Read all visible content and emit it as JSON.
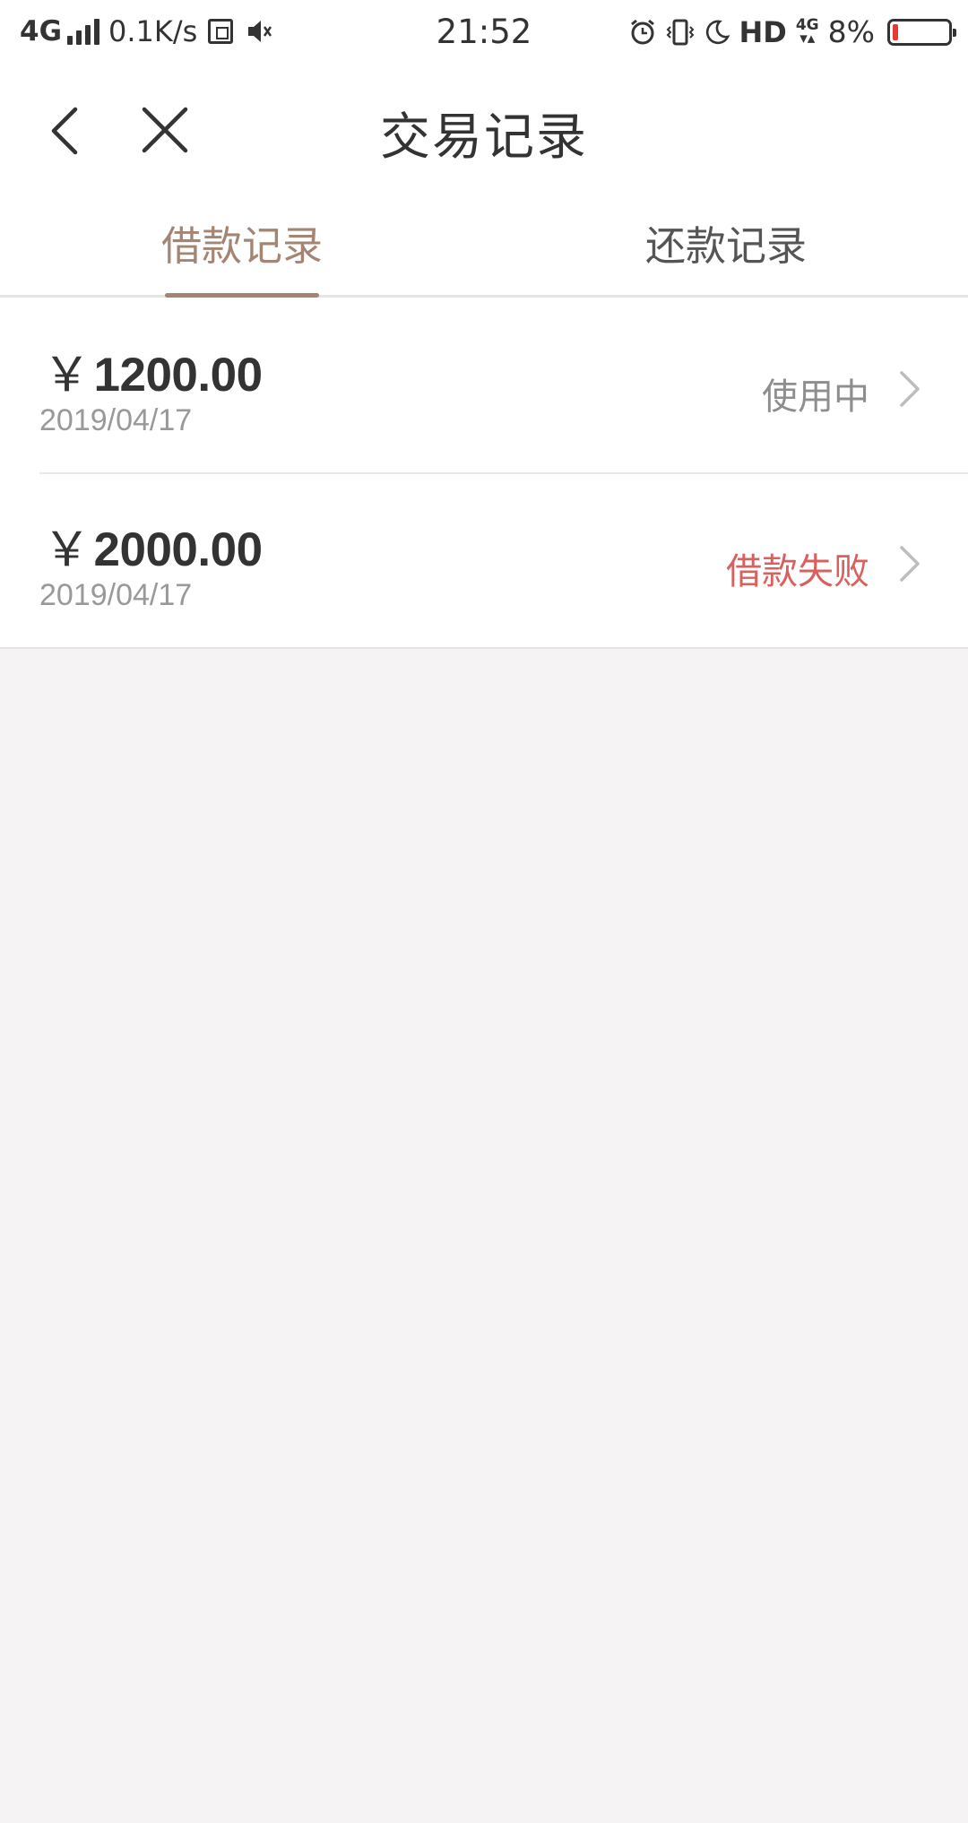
{
  "status_bar": {
    "network": "4G",
    "speed": "0.1K/s",
    "time": "21:52",
    "hd": "HD",
    "mini_4g": "4G",
    "battery_text": "8%",
    "battery_level": 0.08,
    "icons": [
      "signal-icon",
      "sim-icon",
      "mute-icon",
      "alarm-icon",
      "vibrate-icon",
      "moon-icon",
      "battery-icon"
    ]
  },
  "header": {
    "title": "交易记录",
    "back_icon": "chevron-left-icon",
    "close_icon": "close-icon"
  },
  "tabs": [
    {
      "label": "借款记录",
      "active": true
    },
    {
      "label": "还款记录",
      "active": false
    }
  ],
  "records": [
    {
      "currency": "￥",
      "amount": "1200.00",
      "date": "2019/04/17",
      "status": "使用中",
      "status_color": "#8e8e8e"
    },
    {
      "currency": "￥",
      "amount": "2000.00",
      "date": "2019/04/17",
      "status": "借款失败",
      "status_color": "#d8615e"
    }
  ],
  "colors": {
    "accent": "#a48573",
    "fail": "#d8615e",
    "background": "#f5f3f4"
  }
}
